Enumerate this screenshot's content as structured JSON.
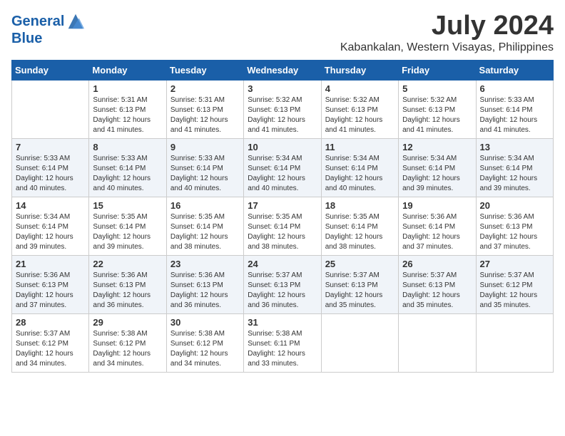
{
  "header": {
    "logo_line1": "General",
    "logo_line2": "Blue",
    "month": "July 2024",
    "location": "Kabankalan, Western Visayas, Philippines"
  },
  "days_of_week": [
    "Sunday",
    "Monday",
    "Tuesday",
    "Wednesday",
    "Thursday",
    "Friday",
    "Saturday"
  ],
  "weeks": [
    [
      {
        "day": "",
        "info": ""
      },
      {
        "day": "1",
        "info": "Sunrise: 5:31 AM\nSunset: 6:13 PM\nDaylight: 12 hours\nand 41 minutes."
      },
      {
        "day": "2",
        "info": "Sunrise: 5:31 AM\nSunset: 6:13 PM\nDaylight: 12 hours\nand 41 minutes."
      },
      {
        "day": "3",
        "info": "Sunrise: 5:32 AM\nSunset: 6:13 PM\nDaylight: 12 hours\nand 41 minutes."
      },
      {
        "day": "4",
        "info": "Sunrise: 5:32 AM\nSunset: 6:13 PM\nDaylight: 12 hours\nand 41 minutes."
      },
      {
        "day": "5",
        "info": "Sunrise: 5:32 AM\nSunset: 6:13 PM\nDaylight: 12 hours\nand 41 minutes."
      },
      {
        "day": "6",
        "info": "Sunrise: 5:33 AM\nSunset: 6:14 PM\nDaylight: 12 hours\nand 41 minutes."
      }
    ],
    [
      {
        "day": "7",
        "info": "Sunrise: 5:33 AM\nSunset: 6:14 PM\nDaylight: 12 hours\nand 40 minutes."
      },
      {
        "day": "8",
        "info": "Sunrise: 5:33 AM\nSunset: 6:14 PM\nDaylight: 12 hours\nand 40 minutes."
      },
      {
        "day": "9",
        "info": "Sunrise: 5:33 AM\nSunset: 6:14 PM\nDaylight: 12 hours\nand 40 minutes."
      },
      {
        "day": "10",
        "info": "Sunrise: 5:34 AM\nSunset: 6:14 PM\nDaylight: 12 hours\nand 40 minutes."
      },
      {
        "day": "11",
        "info": "Sunrise: 5:34 AM\nSunset: 6:14 PM\nDaylight: 12 hours\nand 40 minutes."
      },
      {
        "day": "12",
        "info": "Sunrise: 5:34 AM\nSunset: 6:14 PM\nDaylight: 12 hours\nand 39 minutes."
      },
      {
        "day": "13",
        "info": "Sunrise: 5:34 AM\nSunset: 6:14 PM\nDaylight: 12 hours\nand 39 minutes."
      }
    ],
    [
      {
        "day": "14",
        "info": "Sunrise: 5:34 AM\nSunset: 6:14 PM\nDaylight: 12 hours\nand 39 minutes."
      },
      {
        "day": "15",
        "info": "Sunrise: 5:35 AM\nSunset: 6:14 PM\nDaylight: 12 hours\nand 39 minutes."
      },
      {
        "day": "16",
        "info": "Sunrise: 5:35 AM\nSunset: 6:14 PM\nDaylight: 12 hours\nand 38 minutes."
      },
      {
        "day": "17",
        "info": "Sunrise: 5:35 AM\nSunset: 6:14 PM\nDaylight: 12 hours\nand 38 minutes."
      },
      {
        "day": "18",
        "info": "Sunrise: 5:35 AM\nSunset: 6:14 PM\nDaylight: 12 hours\nand 38 minutes."
      },
      {
        "day": "19",
        "info": "Sunrise: 5:36 AM\nSunset: 6:14 PM\nDaylight: 12 hours\nand 37 minutes."
      },
      {
        "day": "20",
        "info": "Sunrise: 5:36 AM\nSunset: 6:13 PM\nDaylight: 12 hours\nand 37 minutes."
      }
    ],
    [
      {
        "day": "21",
        "info": "Sunrise: 5:36 AM\nSunset: 6:13 PM\nDaylight: 12 hours\nand 37 minutes."
      },
      {
        "day": "22",
        "info": "Sunrise: 5:36 AM\nSunset: 6:13 PM\nDaylight: 12 hours\nand 36 minutes."
      },
      {
        "day": "23",
        "info": "Sunrise: 5:36 AM\nSunset: 6:13 PM\nDaylight: 12 hours\nand 36 minutes."
      },
      {
        "day": "24",
        "info": "Sunrise: 5:37 AM\nSunset: 6:13 PM\nDaylight: 12 hours\nand 36 minutes."
      },
      {
        "day": "25",
        "info": "Sunrise: 5:37 AM\nSunset: 6:13 PM\nDaylight: 12 hours\nand 35 minutes."
      },
      {
        "day": "26",
        "info": "Sunrise: 5:37 AM\nSunset: 6:13 PM\nDaylight: 12 hours\nand 35 minutes."
      },
      {
        "day": "27",
        "info": "Sunrise: 5:37 AM\nSunset: 6:12 PM\nDaylight: 12 hours\nand 35 minutes."
      }
    ],
    [
      {
        "day": "28",
        "info": "Sunrise: 5:37 AM\nSunset: 6:12 PM\nDaylight: 12 hours\nand 34 minutes."
      },
      {
        "day": "29",
        "info": "Sunrise: 5:38 AM\nSunset: 6:12 PM\nDaylight: 12 hours\nand 34 minutes."
      },
      {
        "day": "30",
        "info": "Sunrise: 5:38 AM\nSunset: 6:12 PM\nDaylight: 12 hours\nand 34 minutes."
      },
      {
        "day": "31",
        "info": "Sunrise: 5:38 AM\nSunset: 6:11 PM\nDaylight: 12 hours\nand 33 minutes."
      },
      {
        "day": "",
        "info": ""
      },
      {
        "day": "",
        "info": ""
      },
      {
        "day": "",
        "info": ""
      }
    ]
  ]
}
